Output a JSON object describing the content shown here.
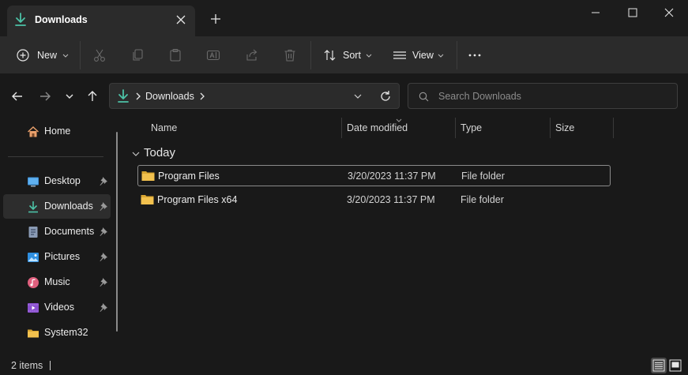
{
  "window": {
    "tab_title": "Downloads",
    "accent_color": "#4cc2a7",
    "folder_color": "#f2c14e"
  },
  "toolbar": {
    "new_label": "New",
    "sort_label": "Sort",
    "view_label": "View",
    "icons": [
      "plus-circle-icon",
      "cut-icon",
      "copy-icon",
      "paste-icon",
      "rename-icon",
      "share-icon",
      "delete-icon",
      "sort-icon",
      "view-icon",
      "more-icon"
    ]
  },
  "address": {
    "location": "Downloads"
  },
  "search": {
    "placeholder": "Search Downloads"
  },
  "sidebar": {
    "items": [
      {
        "label": "Home",
        "icon": "home-icon",
        "pinned": false
      },
      {
        "label": "Desktop",
        "icon": "desktop-icon",
        "pinned": true
      },
      {
        "label": "Downloads",
        "icon": "download-icon",
        "pinned": true,
        "selected": true
      },
      {
        "label": "Documents",
        "icon": "documents-icon",
        "pinned": true
      },
      {
        "label": "Pictures",
        "icon": "pictures-icon",
        "pinned": true
      },
      {
        "label": "Music",
        "icon": "music-icon",
        "pinned": true
      },
      {
        "label": "Videos",
        "icon": "videos-icon",
        "pinned": true
      },
      {
        "label": "System32",
        "icon": "folder-icon",
        "pinned": false
      }
    ]
  },
  "file_list": {
    "columns": [
      "Name",
      "Date modified",
      "Type",
      "Size"
    ],
    "group": "Today",
    "rows": [
      {
        "name": "Program Files",
        "date": "3/20/2023 11:37 PM",
        "type": "File folder",
        "size": ""
      },
      {
        "name": "Program Files x64",
        "date": "3/20/2023 11:37 PM",
        "type": "File folder",
        "size": ""
      }
    ]
  },
  "status": {
    "item_count": "2 items"
  }
}
